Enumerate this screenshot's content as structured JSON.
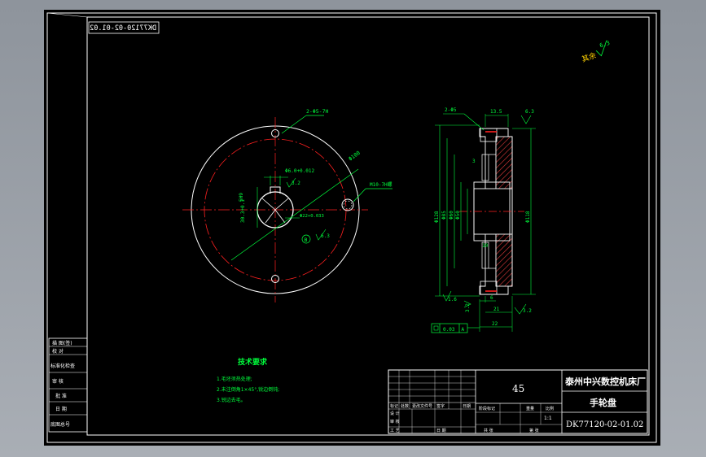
{
  "drawing": {
    "code_box": "DK77120-02-01.02",
    "roughness_note": "其余",
    "roughness_value": "6.3",
    "tech_req": {
      "title": "技术要求",
      "items": [
        "1.毛坯须热处理;",
        "2.未注倒角1×45°,锐边倒钝;",
        "3.锐边去毛。"
      ]
    },
    "front_view_labels": {
      "hole_callout": "2-Φ5-7H",
      "keyway": "Φ6.0+0.012",
      "keyway_ra": "3.2",
      "circle_dia": "Φ100",
      "tap": "M10-7H螺",
      "key_width": "5H9",
      "key_depth": "30.3+0.1",
      "pos_ra": "6.3",
      "datum_b": "B",
      "position_tol": "Φ22+0.033"
    },
    "section_view_labels": {
      "hole": "2-Φ5",
      "width_top": "13.5",
      "ra_top": "6.3",
      "dia_outer": "Φ128",
      "dia_inner1": "Φ85",
      "dia_inner2": "Φ60",
      "dia_inner3": "Φ50",
      "dia_right": "Φ118",
      "dim_3": "3",
      "dim_10": "10",
      "dim_6": "6",
      "dim_21": "21",
      "dim_22": "22",
      "ra_bottom_left": "1.6",
      "ra_bottom_mid": "3.2",
      "ra_bottom_right": "3.2",
      "flatness_tol": "0.03",
      "flatness_datum": "A"
    },
    "left_strip": [
      "描 图(签)",
      "校 对",
      "标准化检查",
      "审 核",
      "批 准",
      "日 期",
      "底图总号"
    ]
  },
  "title_block": {
    "material": "45",
    "company": "泰州中兴数控机床厂",
    "part_name": "手轮盘",
    "drawing_no": "DK77120-02-01.02",
    "scale": "1:1",
    "rev_headers": [
      "标记",
      "处数",
      "更改文件号",
      "签字",
      "日期"
    ],
    "row_labels": [
      "设 计",
      "审 核",
      "工 艺",
      "日 期"
    ],
    "stage_labels": [
      "阶段标记",
      "重量",
      "比例"
    ],
    "sheet_labels": [
      "共 张",
      "第 张"
    ]
  },
  "colors": {
    "frame": "#ffffff",
    "centerline": "#ff2020",
    "dimension": "#00ff3c",
    "hatch": "#e03a3a",
    "accent": "#ffd200"
  }
}
